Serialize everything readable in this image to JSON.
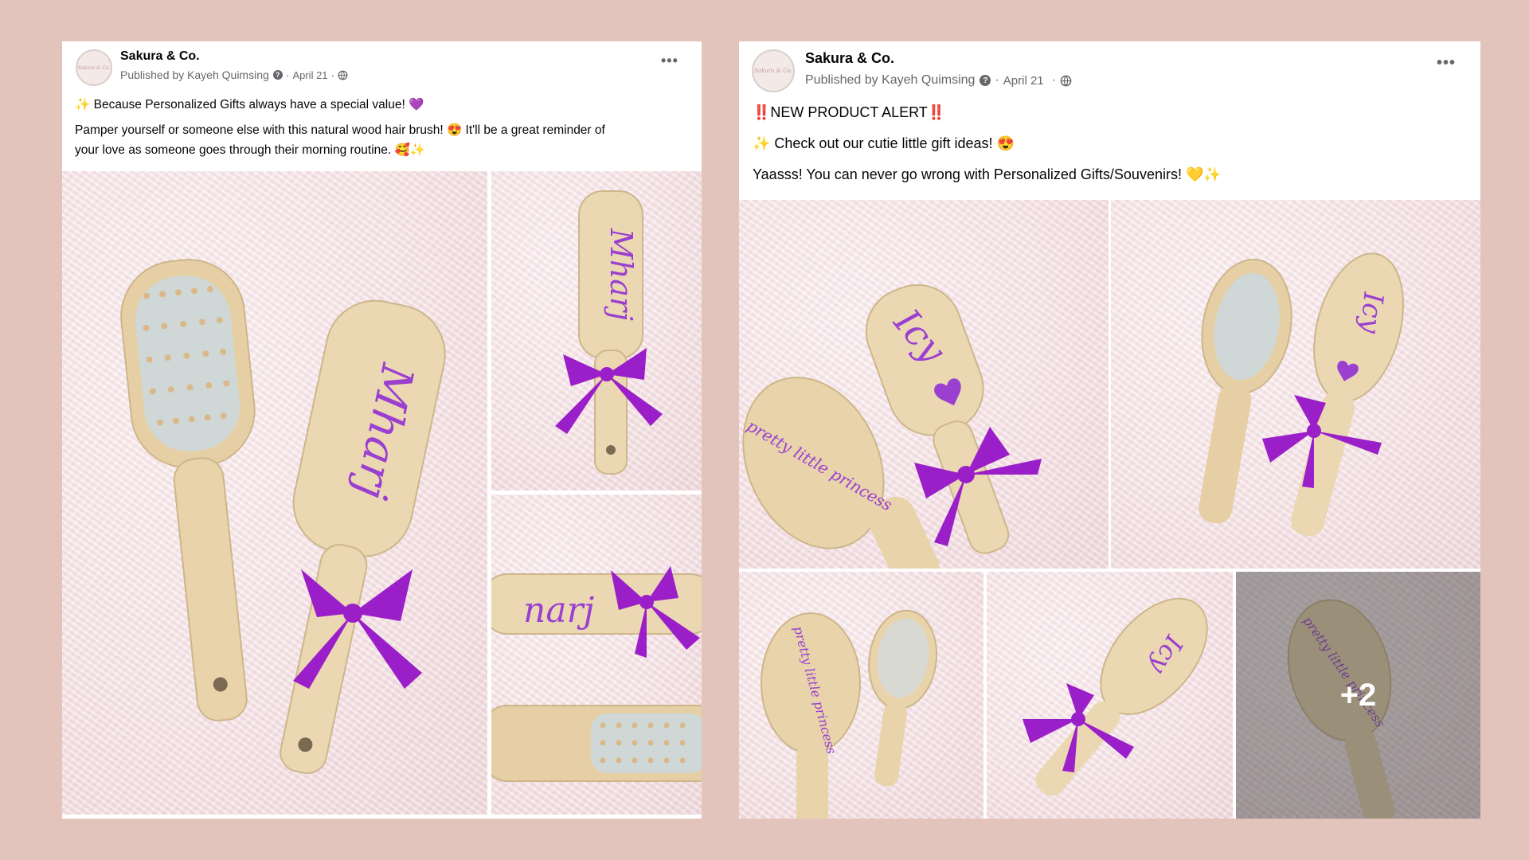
{
  "posts": [
    {
      "page_name": "Sakura & Co.",
      "published_by": "Published by Kayeh Quimsing",
      "date": "April 21",
      "avatar_text": "Sakura & Co.",
      "lines": [
        "✨ Because Personalized Gifts always have a special value! 💜",
        "Pamper yourself or someone else with this natural wood hair brush! 😍 It'll be a great reminder of",
        "your love as someone goes through their morning routine. 🥰✨"
      ],
      "photos": [
        {
          "alt": "Mharj",
          "label": "Mharj"
        },
        {
          "alt": "Mharj",
          "label": "Mharj"
        },
        {
          "alt": "narj",
          "label": "narj"
        }
      ]
    },
    {
      "page_name": "Sakura & Co.",
      "published_by": "Published by Kayeh Quimsing",
      "date": "April 21",
      "avatar_text": "Sakura & Co.",
      "lines": [
        "‼️NEW PRODUCT ALERT‼️",
        "✨ Check out our cutie little gift ideas! 😍",
        "Yaasss! You can never go wrong with Personalized Gifts/Souvenirs! 💛✨"
      ],
      "photos": [
        {
          "alt": "Icy",
          "label": "Icy",
          "label2": "pretty little princess"
        },
        {
          "alt": "Icy",
          "label": "Icy"
        },
        {
          "alt": "pretty little princess",
          "label": "pretty little princess"
        },
        {
          "alt": "Icy",
          "label": "Icy"
        },
        {
          "alt": "pretty little princess",
          "label": "pretty little princess"
        }
      ],
      "more_count": "+2"
    }
  ],
  "colors": {
    "background": "#e3c4bc",
    "card": "#ffffff",
    "ribbon": "#9b1fc9",
    "lettering": "#9a3fd0",
    "wood": "#e8d3ab",
    "fur": "#f4e2e5"
  }
}
